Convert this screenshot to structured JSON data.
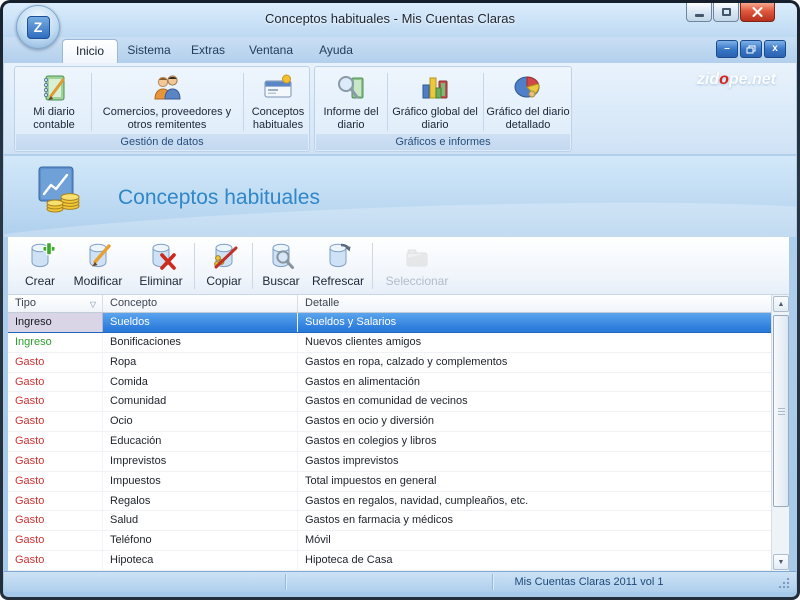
{
  "window": {
    "title": "Conceptos habituales - Mis Cuentas Claras",
    "logo_letter": "Z"
  },
  "tabs": [
    {
      "label": "Inicio",
      "active": true
    },
    {
      "label": "Sistema",
      "active": false
    },
    {
      "label": "Extras",
      "active": false
    },
    {
      "label": "Ventana",
      "active": false
    },
    {
      "label": "Ayuda",
      "active": false
    }
  ],
  "ribbon": {
    "groups": [
      {
        "caption": "Gestión de datos",
        "items": [
          {
            "label": "Mi diario contable",
            "icon": "diary-icon"
          },
          {
            "label": "Comercios, proveedores y otros remitentes",
            "icon": "merchants-icon"
          },
          {
            "label": "Conceptos habituales",
            "icon": "concepts-card-icon"
          }
        ]
      },
      {
        "caption": "Gráficos e informes",
        "items": [
          {
            "label": "Informe del diario",
            "icon": "report-magnifier-icon"
          },
          {
            "label": "Gráfico global del diario",
            "icon": "bar-chart-icon"
          },
          {
            "label": "Gráfico del diario detallado",
            "icon": "pie-chart-icon"
          }
        ]
      }
    ]
  },
  "brand": {
    "pre": "zid",
    "accent": "o",
    "post": "pe.net"
  },
  "page_header": {
    "title": "Conceptos habituales"
  },
  "toolbar": {
    "buttons": [
      {
        "label": "Crear",
        "icon": "create-icon",
        "disabled": false
      },
      {
        "label": "Modificar",
        "icon": "modify-icon",
        "disabled": false
      },
      {
        "label": "Eliminar",
        "icon": "delete-icon",
        "disabled": false
      },
      {
        "label": "Copiar",
        "icon": "copy-icon",
        "disabled": false
      },
      {
        "label": "Buscar",
        "icon": "search-icon",
        "disabled": false
      },
      {
        "label": "Refrescar",
        "icon": "refresh-icon",
        "disabled": false
      },
      {
        "label": "Seleccionar",
        "icon": "select-icon",
        "disabled": true
      }
    ]
  },
  "table": {
    "columns": [
      "Tipo",
      "Concepto",
      "Detalle"
    ],
    "sort_column": "Tipo",
    "type_colors": {
      "Ingreso": "#2e9e2e",
      "Gasto": "#cc3333"
    },
    "rows": [
      {
        "tipo": "Ingreso",
        "concepto": "Sueldos",
        "detalle": "Sueldos y Salarios",
        "selected": true
      },
      {
        "tipo": "Ingreso",
        "concepto": "Bonificaciones",
        "detalle": "Nuevos clientes amigos",
        "selected": false
      },
      {
        "tipo": "Gasto",
        "concepto": "Ropa",
        "detalle": "Gastos en ropa, calzado y complementos",
        "selected": false
      },
      {
        "tipo": "Gasto",
        "concepto": "Comida",
        "detalle": "Gastos en alimentación",
        "selected": false
      },
      {
        "tipo": "Gasto",
        "concepto": "Comunidad",
        "detalle": "Gastos en comunidad de vecinos",
        "selected": false
      },
      {
        "tipo": "Gasto",
        "concepto": "Ocio",
        "detalle": "Gastos en ocio y diversión",
        "selected": false
      },
      {
        "tipo": "Gasto",
        "concepto": "Educación",
        "detalle": "Gastos en colegios y libros",
        "selected": false
      },
      {
        "tipo": "Gasto",
        "concepto": "Imprevistos",
        "detalle": "Gastos imprevistos",
        "selected": false
      },
      {
        "tipo": "Gasto",
        "concepto": "Impuestos",
        "detalle": "Total impuestos en general",
        "selected": false
      },
      {
        "tipo": "Gasto",
        "concepto": "Regalos",
        "detalle": "Gastos en regalos, navidad, cumpleaños, etc.",
        "selected": false
      },
      {
        "tipo": "Gasto",
        "concepto": "Salud",
        "detalle": "Gastos en farmacia y médicos",
        "selected": false
      },
      {
        "tipo": "Gasto",
        "concepto": "Teléfono",
        "detalle": "Móvil",
        "selected": false
      },
      {
        "tipo": "Gasto",
        "concepto": "Hipoteca",
        "detalle": "Hipoteca de Casa",
        "selected": false
      }
    ]
  },
  "status_bar": {
    "text": "Mis Cuentas Claras 2011 vol 1"
  },
  "icons": {
    "sort_indicator": "▽",
    "scroll_up": "▲",
    "scroll_down": "▼",
    "mdi_minimize": "–",
    "mdi_close": "x"
  },
  "colors": {
    "selection_blue": "#2b7bdb",
    "ingreso_green": "#2e9e2e",
    "gasto_red": "#cc3333",
    "header_title_blue": "#2f87c9"
  }
}
